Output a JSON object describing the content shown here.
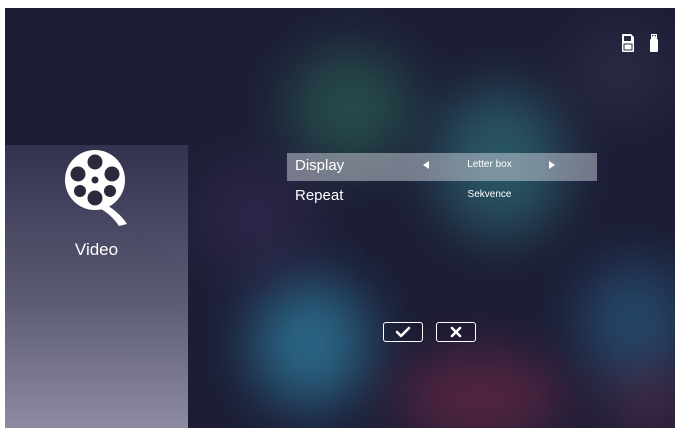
{
  "app": {
    "title": "Video"
  },
  "status_icons": [
    "sd-card-icon",
    "usb-drive-icon"
  ],
  "settings": [
    {
      "label": "Display",
      "value": "Letter box",
      "selected": true
    },
    {
      "label": "Repeat",
      "value": "Sekvence",
      "selected": false
    }
  ],
  "actions": {
    "confirm_icon": "checkmark-icon",
    "cancel_icon": "x-icon"
  },
  "colors": {
    "highlight": "#e1e1eb",
    "background": "#1c1d35",
    "text": "#ffffff"
  }
}
